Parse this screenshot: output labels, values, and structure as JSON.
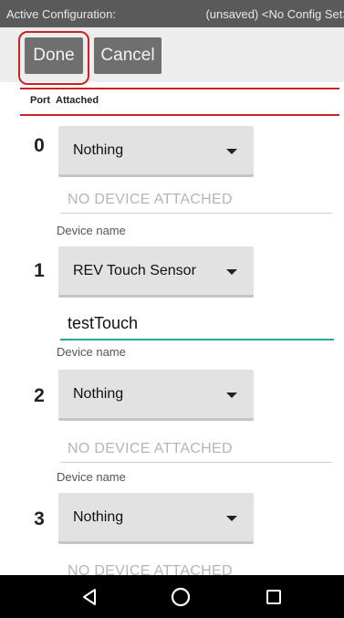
{
  "status_bar": {
    "left": "Active Configuration:",
    "right": "(unsaved) <No Config Set>"
  },
  "toolbar": {
    "done_label": "Done",
    "cancel_label": "Cancel"
  },
  "header": {
    "port": "Port",
    "attached": "Attached"
  },
  "ports": [
    {
      "number": "0",
      "device": "Nothing",
      "status": "NO DEVICE ATTACHED",
      "device_name_label": "Device name"
    },
    {
      "number": "1",
      "device": "REV Touch Sensor",
      "name_value": "testTouch",
      "device_name_label": "Device name"
    },
    {
      "number": "2",
      "device": "Nothing",
      "status": "NO DEVICE ATTACHED",
      "device_name_label": "Device name"
    },
    {
      "number": "3",
      "device": "Nothing",
      "status": "NO DEVICE ATTACHED"
    }
  ],
  "colors": {
    "highlight": "#cc2222",
    "input_accent": "#2ba6a6",
    "toolbar_button": "#6f6f6f"
  },
  "nav_icons": [
    "back-icon",
    "home-icon",
    "recents-icon"
  ]
}
